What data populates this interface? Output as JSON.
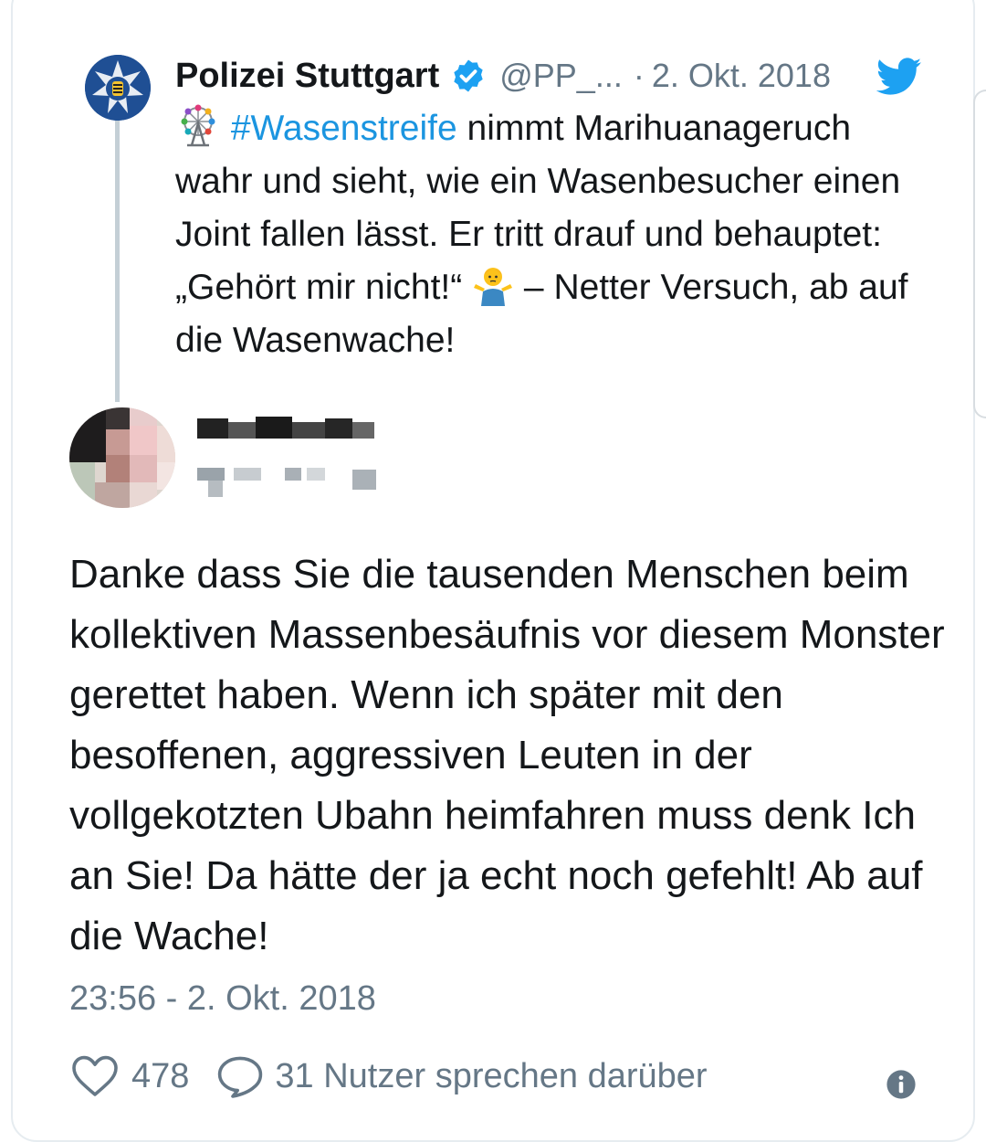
{
  "parent_tweet": {
    "author_name": "Polizei Stuttgart",
    "handle": "@PP_...",
    "separator": "·",
    "date": "2. Okt. 2018",
    "hashtag": "#Wasenstreife",
    "text_part1": " nimmt Marihuanageruch wahr und sieht, wie ein Wasenbesucher einen Joint fallen lässt. Er tritt drauf und behauptet: „Gehört mir nicht!“ ",
    "text_part2": " – Netter Versuch, ab auf die Wasenwache!"
  },
  "reply_tweet": {
    "text": "Danke dass Sie die tausenden Menschen beim kollektiven Massenbesäufnis vor diesem Monster gerettet haben. Wenn ich später mit den besoffenen, aggressiven Leuten in der vollgekotzten Ubahn heimfahren muss denk Ich an Sie! Da hätte der ja echt noch gefehlt! Ab auf die Wache!",
    "timestamp": "23:56 - 2. Okt. 2018",
    "likes": "478",
    "comments_label": "31 Nutzer sprechen darüber"
  },
  "icons": {
    "verified": "verified-badge-icon",
    "brand": "twitter-bird-icon",
    "like": "heart-icon",
    "reply": "speech-bubble-icon",
    "info": "info-icon"
  },
  "colors": {
    "link": "#1b95e0",
    "secondary_text": "#657786",
    "primary_text": "#14171a"
  }
}
